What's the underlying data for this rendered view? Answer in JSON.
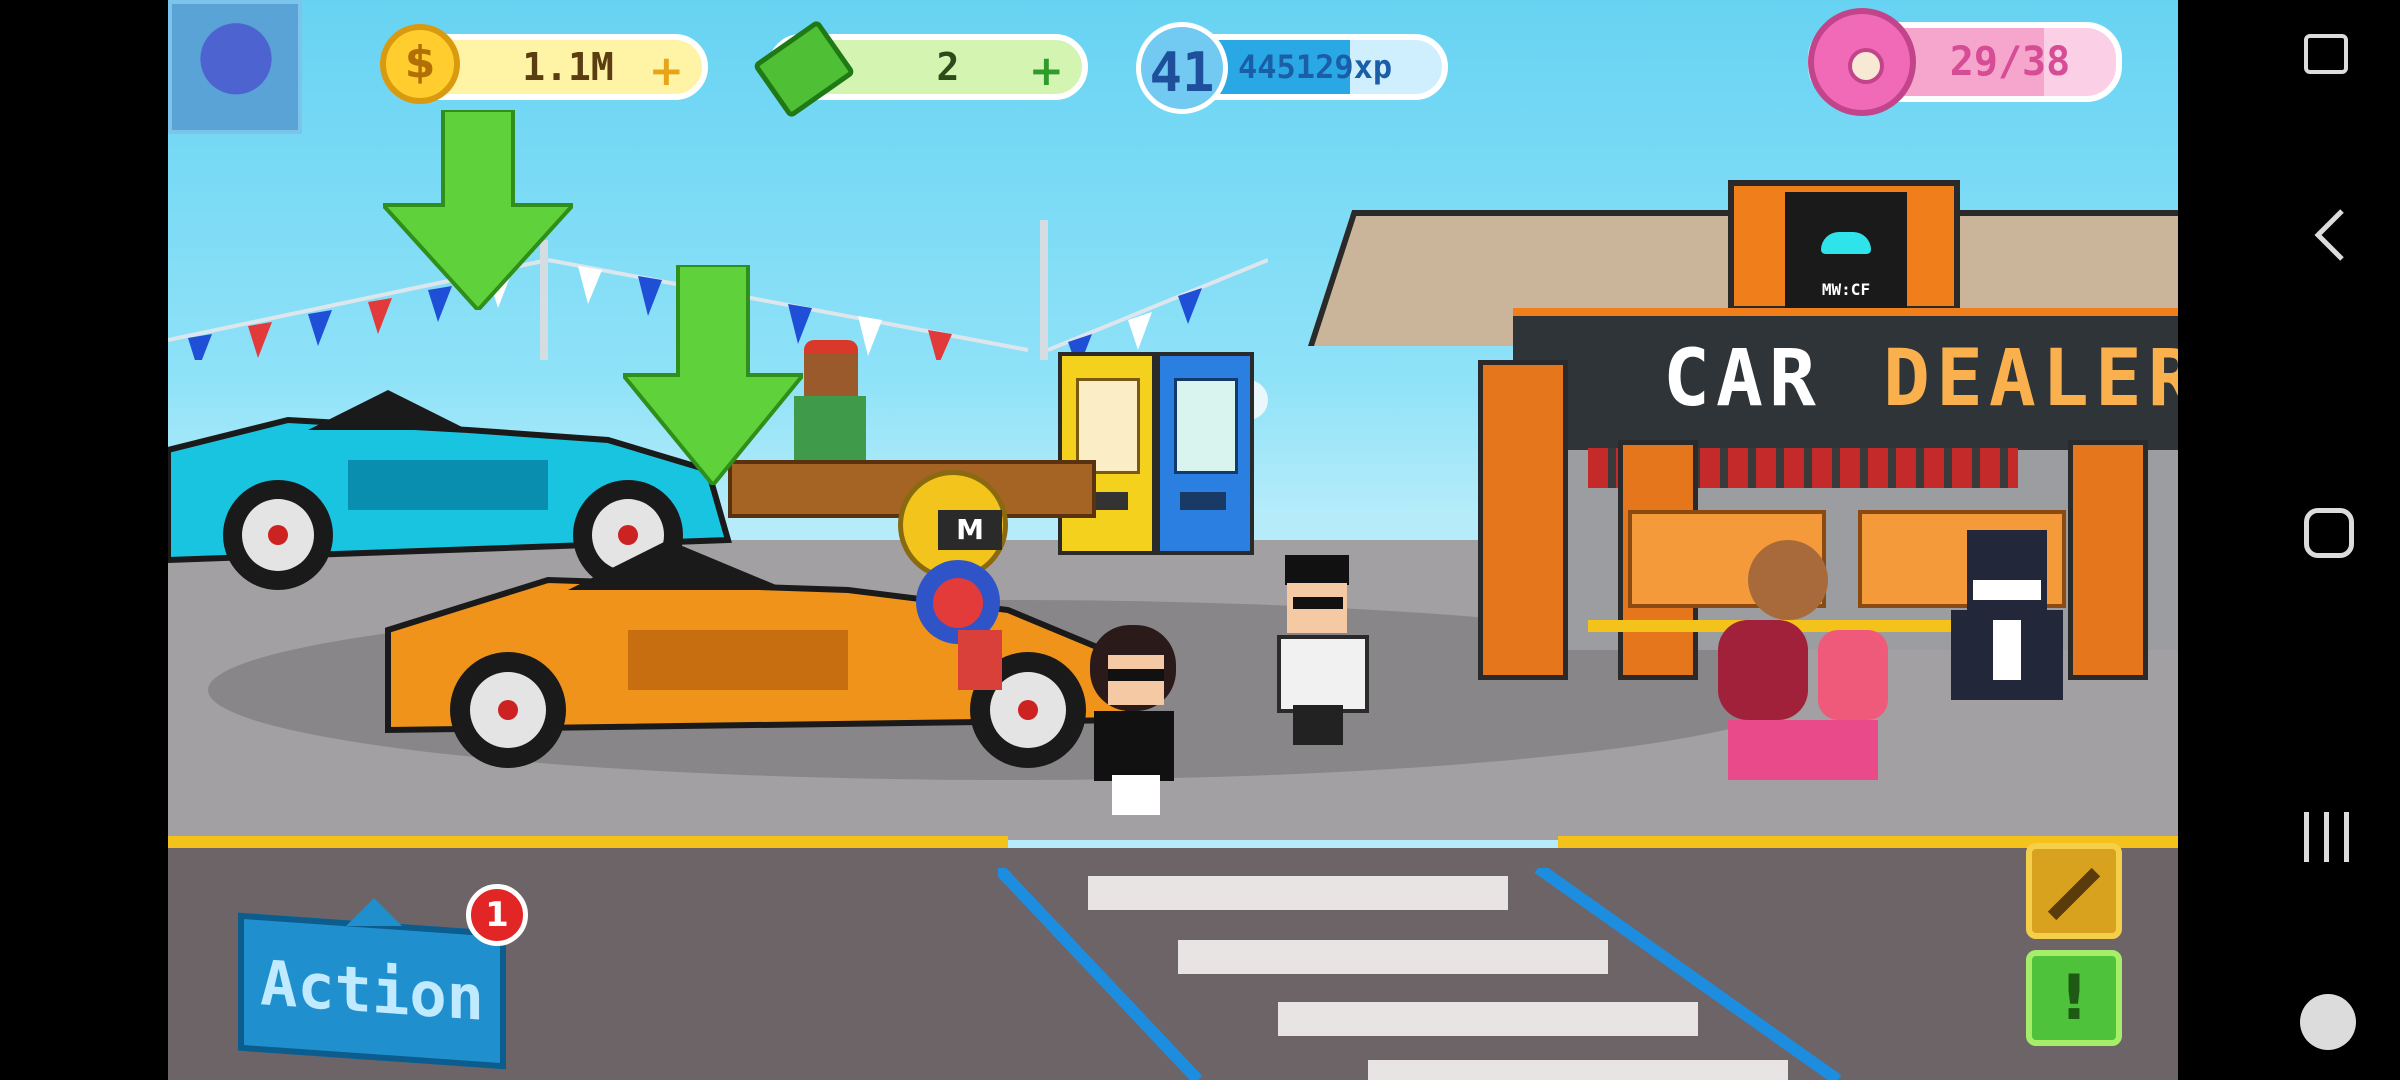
{
  "hud": {
    "coins": "1.1M",
    "cash": "2",
    "level": "41",
    "xp": "445129xp",
    "donuts": "29/38"
  },
  "building": {
    "sign_left": "CAR",
    "sign_right": "DEALER",
    "logo_text": "MW:CF"
  },
  "npc_badge": "M",
  "action": {
    "label": "Action",
    "badge": "1"
  },
  "colors": {
    "coin": "#ffce2e",
    "cash": "#a6e86d",
    "xp": "#2aa8e6",
    "donut": "#f06ab7",
    "accent": "#f28a1e"
  },
  "side_nav": {
    "icons": [
      "screenshot-edit-icon",
      "back-icon",
      "home-icon",
      "recents-icon",
      "game-launcher-icon"
    ]
  }
}
